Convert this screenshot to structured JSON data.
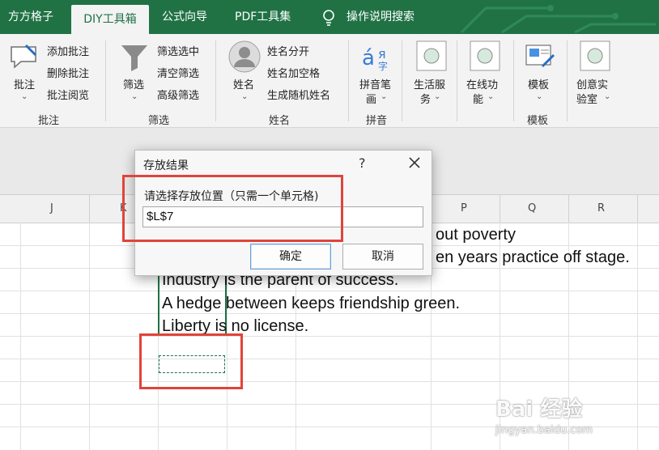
{
  "tabs": [
    {
      "label": "方方格子"
    },
    {
      "label": "DIY工具箱"
    },
    {
      "label": "公式向导"
    },
    {
      "label": "PDF工具集"
    },
    {
      "label": "操作说明搜索"
    }
  ],
  "ribbon": {
    "annotation": {
      "big_label": "批注",
      "add": "添加批注",
      "delete": "删除批注",
      "read": "批注阅览",
      "group": "批注"
    },
    "filter": {
      "big_label": "筛选",
      "filter_selected": "筛选选中",
      "clear_filter": "清空筛选",
      "advanced_filter": "高级筛选",
      "group": "筛选"
    },
    "name": {
      "big_label": "姓名",
      "split": "姓名分开",
      "add_space": "姓名加空格",
      "random": "生成随机姓名",
      "group": "姓名"
    },
    "pinyin": {
      "big_label_1": "拼音笔",
      "big_label_2": "画",
      "group": "拼音",
      "icon_text": "á"
    },
    "life_service": {
      "label_1": "生活服",
      "label_2": "务"
    },
    "online": {
      "label_1": "在线功",
      "label_2": "能"
    },
    "template": {
      "big_label": "模板",
      "group": "模板"
    },
    "creative": {
      "label_1": "创意实",
      "label_2": "验室"
    }
  },
  "columns": [
    "J",
    "K",
    "P",
    "Q",
    "R"
  ],
  "cells": [
    "out poverty",
    "en years practice off stage.",
    "Industry is the parent of success.",
    "A hedge between keeps friendship green.",
    "Liberty is no license."
  ],
  "dialog": {
    "title": "存放结果",
    "help": "?",
    "prompt": "请选择存放位置（只需一个单元格)",
    "input_value": "$L$7",
    "ok": "确定",
    "cancel": "取消"
  },
  "watermark": {
    "brand": "Bai 经验",
    "url": "jingyan.baidu.com"
  },
  "colors": {
    "excel_green": "#207245",
    "highlight_red": "#e0443a",
    "selection_green": "#1e7145"
  }
}
